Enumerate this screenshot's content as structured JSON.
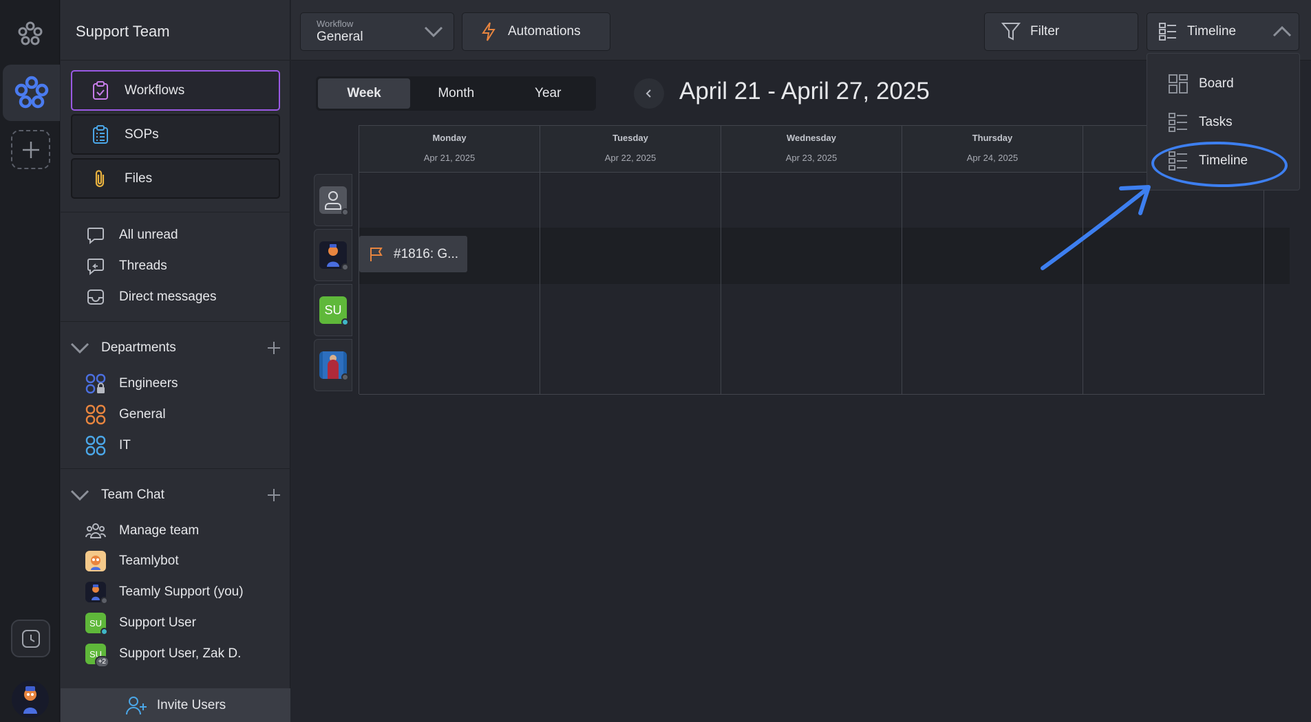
{
  "sidebar": {
    "team_name": "Support Team",
    "nav": [
      {
        "label": "Workflows",
        "active": true
      },
      {
        "label": "SOPs"
      },
      {
        "label": "Files"
      }
    ],
    "inbox": [
      {
        "label": "All unread"
      },
      {
        "label": "Threads"
      },
      {
        "label": "Direct messages"
      }
    ],
    "departments": {
      "title": "Departments",
      "items": [
        {
          "label": "Engineers",
          "color": "#4b6fe0"
        },
        {
          "label": "General",
          "color": "#e8853f"
        },
        {
          "label": "IT",
          "color": "#4ba7e8"
        }
      ]
    },
    "team_chat": {
      "title": "Team Chat",
      "items": [
        {
          "label": "Manage team"
        },
        {
          "label": "Teamlybot"
        },
        {
          "label": "Teamly Support (you)"
        },
        {
          "label": "Support User",
          "initials": "SU"
        },
        {
          "label": "Support User, Zak D.",
          "initials": "SU",
          "badge": "+2"
        }
      ]
    },
    "invite_label": "Invite Users"
  },
  "topbar": {
    "workflow_label": "Workflow",
    "workflow_value": "General",
    "automations_label": "Automations",
    "filter_label": "Filter",
    "view_label": "Timeline"
  },
  "calendar": {
    "range_tabs": [
      {
        "label": "Week",
        "selected": true
      },
      {
        "label": "Month"
      },
      {
        "label": "Year"
      }
    ],
    "title": "April 21 - April 27, 2025",
    "days": [
      {
        "day": "Monday",
        "date": "Apr 21, 2025"
      },
      {
        "day": "Tuesday",
        "date": "Apr 22, 2025"
      },
      {
        "day": "Wednesday",
        "date": "Apr 23, 2025"
      },
      {
        "day": "Thursday",
        "date": "Apr 24, 2025"
      },
      {
        "day": "",
        "date": ""
      }
    ],
    "users": [
      {
        "initials": "",
        "status": "offline"
      },
      {
        "initials": "",
        "status": "offline"
      },
      {
        "initials": "SU",
        "status": "online"
      },
      {
        "initials": "",
        "status": "offline"
      }
    ],
    "task_label": "#1816: G..."
  },
  "view_menu": {
    "items": [
      {
        "label": "Board"
      },
      {
        "label": "Tasks"
      },
      {
        "label": "Timeline",
        "selected": true
      }
    ]
  },
  "colors": {
    "accent_purple": "#9a59e4",
    "accent_blue": "#3d7ff0",
    "online_green": "#5fb83a",
    "automation_orange": "#e8853f"
  }
}
